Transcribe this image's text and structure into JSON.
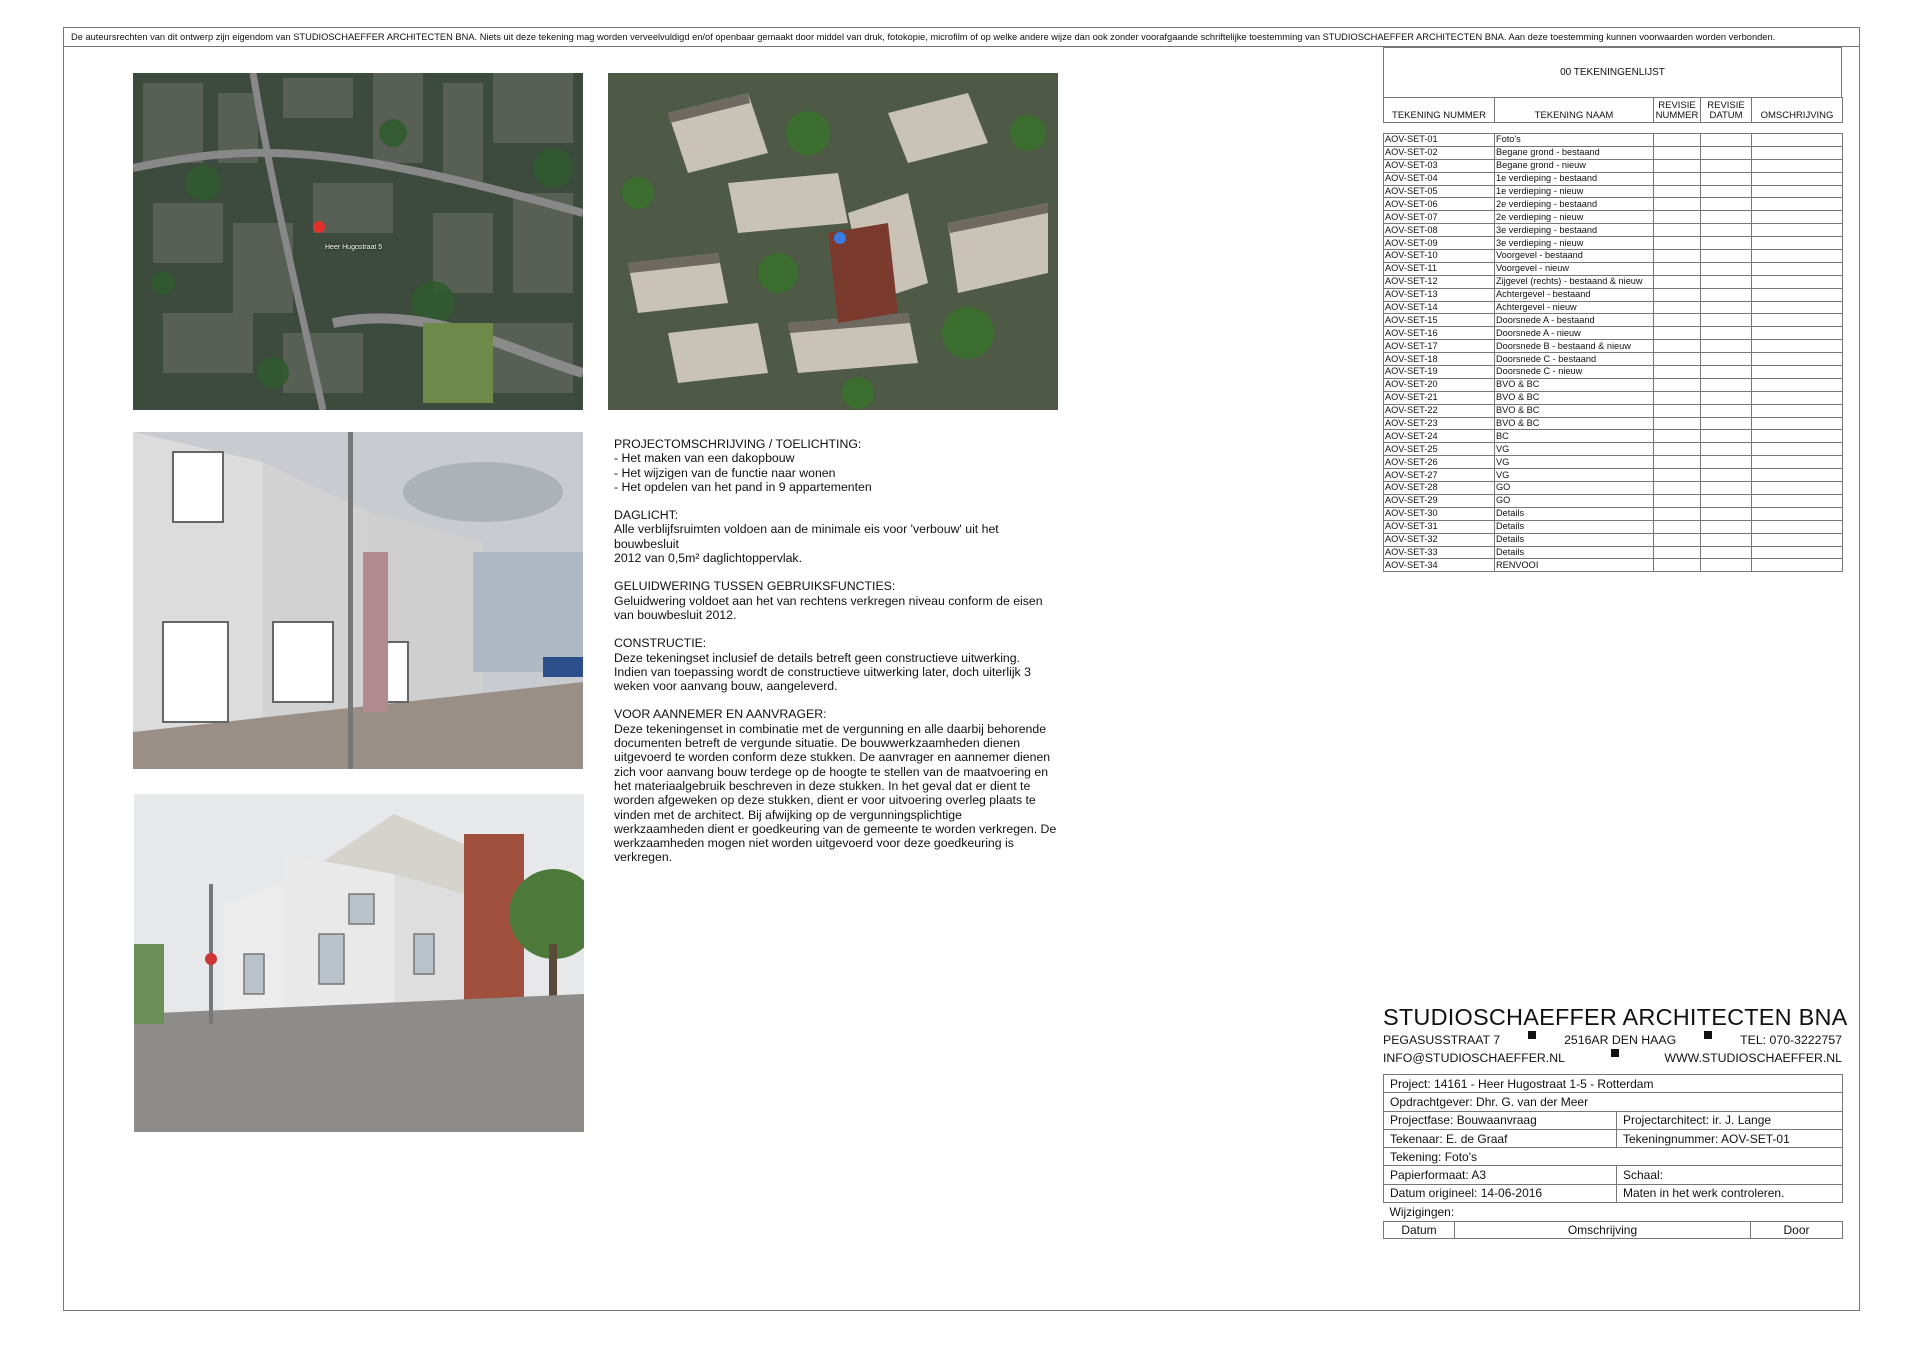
{
  "copyright": "De auteursrechten van dit ontwerp zijn eigendom van STUDIOSCHAEFFER ARCHITECTEN BNA. Niets uit deze tekening mag worden verveelvuldigd en/of openbaar gemaakt door middel van druk, fotokopie, microfilm of op welke andere wijze dan ook zonder voorafgaande schriftelijke toestemming van STUDIOSCHAEFFER ARCHITECTEN BNA. Aan deze toestemming kunnen voorwaarden worden verbonden.",
  "map_label": "Heer Hugostraat 5",
  "description": {
    "s1_title": "PROJECTOMSCHRIJVING / TOELICHTING:",
    "s1_l1": "- Het maken van een dakopbouw",
    "s1_l2": "- Het wijzigen van de functie naar wonen",
    "s1_l3": "- Het opdelen van het pand in 9 appartementen",
    "s2_title": "DAGLICHT:",
    "s2_l1": "Alle verblijfsruimten voldoen aan de minimale eis voor 'verbouw' uit het",
    "s2_l2": "bouwbesluit",
    "s2_l3": "2012 van 0,5m² daglichtoppervlak.",
    "s3_title": "GELUIDWERING TUSSEN GEBRUIKSFUNCTIES:",
    "s3_l1": "Geluidwering voldoet aan het van rechtens verkregen niveau conform de eisen",
    "s3_l2": "van bouwbesluit 2012.",
    "s4_title": "CONSTRUCTIE:",
    "s4_l1": "Deze tekeningset inclusief de details betreft geen constructieve uitwerking.",
    "s4_l2": "Indien van toepassing wordt de constructieve uitwerking later, doch uiterlijk 3",
    "s4_l3": "weken voor aanvang bouw, aangeleverd.",
    "s5_title": "VOOR AANNEMER EN AANVRAGER:",
    "s5_lines": [
      "Deze tekeningenset in combinatie met de vergunning en alle daarbij behorende",
      "documenten betreft de vergunde situatie. De bouwwerkzaamheden dienen",
      "uitgevoerd te worden conform deze stukken. De aanvrager en aannemer dienen",
      "zich voor aanvang bouw terdege op de hoogte te stellen van de maatvoering en",
      "het materiaalgebruik beschreven in deze stukken. In het geval dat er dient te",
      "worden afgeweken op deze stukken, dient er voor uitvoering overleg plaats te",
      "vinden met de architect. Bij afwijking op de vergunningsplichtige",
      "werkzaamheden dient er goedkeuring van de gemeente te worden verkregen. De",
      "werkzaamheden mogen niet worden uitgevoerd voor deze goedkeuring is",
      "verkregen."
    ]
  },
  "drawing_list": {
    "title": "00 TEKENINGENLIJST",
    "headers": {
      "nummer": "TEKENING NUMMER",
      "naam": "TEKENING NAAM",
      "revisie_nummer_1": "REVISIE",
      "revisie_nummer_2": "NUMMER",
      "revisie_datum_1": "REVISIE",
      "revisie_datum_2": "DATUM",
      "omschrijving": "OMSCHRIJVING"
    },
    "rows": [
      [
        "AOV-SET-01",
        "Foto's"
      ],
      [
        "AOV-SET-02",
        "Begane grond - bestaand"
      ],
      [
        "AOV-SET-03",
        "Begane grond - nieuw"
      ],
      [
        "AOV-SET-04",
        "1e verdieping - bestaand"
      ],
      [
        "AOV-SET-05",
        "1e verdieping - nieuw"
      ],
      [
        "AOV-SET-06",
        "2e verdieping - bestaand"
      ],
      [
        "AOV-SET-07",
        "2e verdieping - nieuw"
      ],
      [
        "AOV-SET-08",
        "3e verdieping - bestaand"
      ],
      [
        "AOV-SET-09",
        "3e verdieping - nieuw"
      ],
      [
        "AOV-SET-10",
        "Voorgevel - bestaand"
      ],
      [
        "AOV-SET-11",
        "Voorgevel - nieuw"
      ],
      [
        "AOV-SET-12",
        "Zijgevel (rechts) - bestaand & nieuw"
      ],
      [
        "AOV-SET-13",
        "Achtergevel - bestaand"
      ],
      [
        "AOV-SET-14",
        "Achtergevel - nieuw"
      ],
      [
        "AOV-SET-15",
        "Doorsnede A - bestaand"
      ],
      [
        "AOV-SET-16",
        "Doorsnede A - nieuw"
      ],
      [
        "AOV-SET-17",
        "Doorsnede B - bestaand & nieuw"
      ],
      [
        "AOV-SET-18",
        "Doorsnede C - bestaand"
      ],
      [
        "AOV-SET-19",
        "Doorsnede C - nieuw"
      ],
      [
        "AOV-SET-20",
        "BVO & BC"
      ],
      [
        "AOV-SET-21",
        "BVO & BC"
      ],
      [
        "AOV-SET-22",
        "BVO & BC"
      ],
      [
        "AOV-SET-23",
        "BVO & BC"
      ],
      [
        "AOV-SET-24",
        "BC"
      ],
      [
        "AOV-SET-25",
        "VG"
      ],
      [
        "AOV-SET-26",
        "VG"
      ],
      [
        "AOV-SET-27",
        "VG"
      ],
      [
        "AOV-SET-28",
        "GO"
      ],
      [
        "AOV-SET-29",
        "GO"
      ],
      [
        "AOV-SET-30",
        "Details"
      ],
      [
        "AOV-SET-31",
        "Details"
      ],
      [
        "AOV-SET-32",
        "Details"
      ],
      [
        "AOV-SET-33",
        "Details"
      ],
      [
        "AOV-SET-34",
        "RENVOOI"
      ]
    ]
  },
  "firm": {
    "name": "STUDIOSCHAEFFER ARCHITECTEN BNA",
    "street": "PEGASUSSTRAAT 7",
    "city": "2516AR DEN HAAG",
    "tel": "TEL: 070-3222757",
    "email": "INFO@STUDIOSCHAEFFER.NL",
    "web": "WWW.STUDIOSCHAEFFER.NL"
  },
  "titleblock": {
    "project": "Project: 14161 - Heer Hugostraat 1-5 - Rotterdam",
    "opdrachtgever": "Opdrachtgever: Dhr. G. van der Meer",
    "projectfase": "Projectfase: Bouwaanvraag",
    "projectarchitect": "Projectarchitect: ir. J. Lange",
    "tekenaar": "Tekenaar: E. de Graaf",
    "tekeningnummer": "Tekeningnummer:  AOV-SET-01",
    "tekening": "Tekening: Foto's",
    "papierformaat": "Papierformaat: A3",
    "schaal": "Schaal:",
    "datum": "Datum origineel: 14-06-2016",
    "maten": "Maten in het werk controleren.",
    "wijzigingen": "Wijzigingen:",
    "col_datum": "Datum",
    "col_omschrijving": "Omschrijving",
    "col_door": "Door"
  },
  "accent_colors": {
    "pin": "#e0322b",
    "marker": "#3a7be0"
  }
}
